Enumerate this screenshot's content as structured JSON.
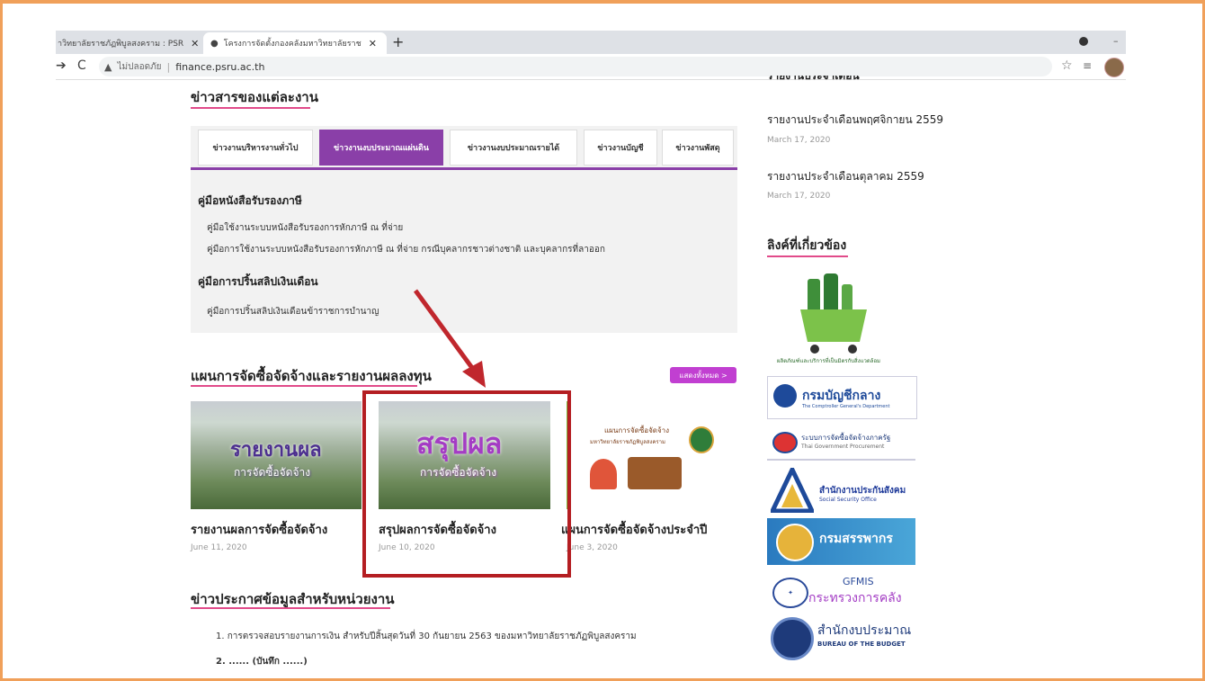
{
  "browser": {
    "tabs": [
      {
        "label": "าวิทยาลัยราชภัฏพิบูลสงคราม : PSR"
      },
      {
        "label": "โครงการจัดตั้งกองคลังมหาวิทยาลัยราช"
      }
    ],
    "address": {
      "security_label": "ไม่ปลอดภัย",
      "url": "finance.psru.ac.th"
    }
  },
  "main": {
    "news_title": "ข่าวสารของแต่ละงาน",
    "tabs": [
      {
        "label": "ข่าวงานบริหารงานทั่วไป"
      },
      {
        "label": "ข่าวงานงบประมาณแผ่นดิน"
      },
      {
        "label": "ข่าวงานงบประมาณรายได้"
      },
      {
        "label": "ข่าวงานบัญชี"
      },
      {
        "label": "ข่าวงานพัสดุ"
      }
    ],
    "panel": {
      "heading1": "คู่มือหนังสือรับรองภาษี",
      "link1": "คู่มือใช้งานระบบหนังสือรับรองการหักภาษี ณ ที่จ่าย",
      "link2": "คู่มือการใช้งานระบบหนังสือรับรองการหักภาษี ณ ที่จ่าย กรณีบุคลากรชาวต่างชาติ และบุคลากรที่ลาออก",
      "heading2": "คู่มือการปริ้นสลิปเงินเดือน",
      "link3": "คู่มือการปริ้นสลิปเงินเดือนข้าราชการบำนาญ"
    },
    "plan_title": "แผนการจัดซื้อจัดจ้างและรายงานผลลงทุน",
    "more_button": "แสดงทั้งหมด >",
    "cards": [
      {
        "img_text1": "รายงานผล",
        "img_text2": "การจัดซื้อจัดจ้าง",
        "title": "รายงานผลการจัดซื้อจัดจ้าง",
        "date": "June 11, 2020"
      },
      {
        "img_text1": "สรุปผล",
        "img_text2": "การจัดซื้อจัดจ้าง",
        "title": "สรุปผลการจัดซื้อจัดจ้าง",
        "date": "June 10, 2020"
      },
      {
        "img_text1": "แผนการจัดซื้อจัดจ้าง",
        "img_text2": "มหาวิทยาลัยราชภัฏพิบูลสงคราม",
        "title": "แผนการจัดซื้อจัดจ้างประจำปี",
        "date": "June 3, 2020"
      }
    ],
    "announce_title": "ข่าวประกาศข้อมูลสำหรับหน่วยงาน",
    "announce_item1": "1. การตรวจสอบรายงานการเงิน สำหรับปีสิ้นสุดวันที่ 30 กันยายน 2563 ของมหาวิทยาลัยราชภัฏพิบูลสงคราม",
    "announce_item2": "2. ...... (บันทึก ......)"
  },
  "sidebar": {
    "report_heading": "รายงานประจำเดือน",
    "reports": [
      {
        "title": "รายงานประจำเดือนพฤศจิกายน 2559",
        "date": "March 17, 2020"
      },
      {
        "title": "รายงานประจำเดือนตุลาคม 2559",
        "date": "March 17, 2020"
      }
    ],
    "links_title": "ลิงค์ที่เกี่ยวข้อง",
    "logos": {
      "green": "ผลิตภัณฑ์และบริการที่เป็นมิตรกับสิ่งแวดล้อม",
      "cgd_th": "กรมบัญชีกลาง",
      "cgd_en": "The Comptroller General's Department",
      "gp_th": "ระบบการจัดซื้อจัดจ้างภาครัฐ",
      "gp_en": "Thai Government Procurement",
      "sso_th": "สำนักงานประกันสังคม",
      "sso_en": "Social Security Office",
      "rd_th": "กรมสรรพากร",
      "gfmis": "GFMIS",
      "gfmis_sub": "กระทรวงการคลัง",
      "bb_th": "สำนักงบประมาณ",
      "bb_en": "BUREAU OF THE BUDGET"
    }
  },
  "colors": {
    "accent": "#8a3fa8",
    "underline": "#e14b8a",
    "highlight_box": "#b41e22",
    "frame": "#f0a05a"
  }
}
